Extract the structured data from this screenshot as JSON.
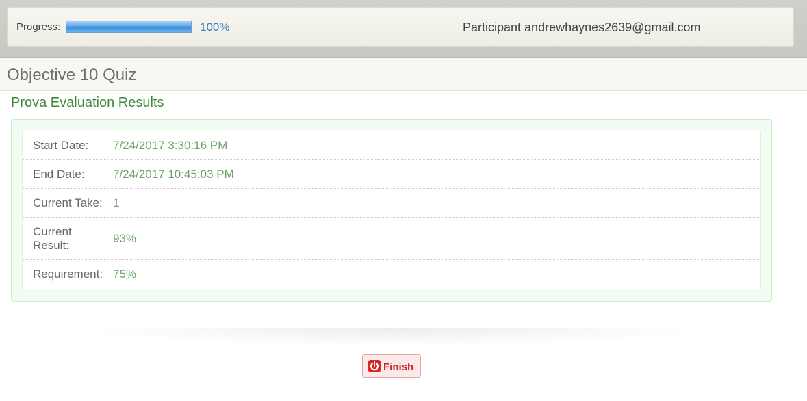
{
  "header": {
    "progress_label": "Progress:",
    "progress_value": "100%",
    "progress_fraction": 1.0,
    "participant": "Participant andrewhaynes2639@gmail.com"
  },
  "page": {
    "title": "Objective 10 Quiz"
  },
  "results": {
    "section_title": "Prova Evaluation Results",
    "rows": [
      {
        "label": "Start Date:",
        "value": "7/24/2017 3:30:16 PM"
      },
      {
        "label": "End Date:",
        "value": "7/24/2017 10:45:03 PM"
      },
      {
        "label": "Current Take:",
        "value": "1"
      },
      {
        "label": "Current Result:",
        "value": "93%"
      },
      {
        "label": "Requirement:",
        "value": "75%"
      }
    ]
  },
  "actions": {
    "finish_label": "Finish",
    "finish_icon": "power-icon"
  },
  "colors": {
    "accent_green": "#3f8a3a",
    "value_green": "#6fa36a",
    "finish_red": "#d8272a",
    "progress_blue": "#3a8ddc"
  }
}
